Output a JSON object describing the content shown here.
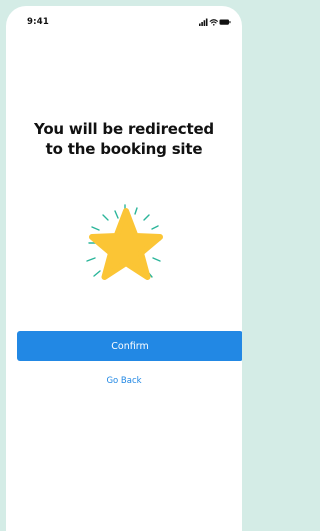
{
  "status_bar": {
    "time": "9:41",
    "signal_icon": "cellular-signal-icon",
    "wifi_icon": "wifi-icon",
    "battery_icon": "battery-icon"
  },
  "dialog": {
    "title_line_1": "You will be redirected",
    "title_line_2": "to the booking site",
    "illustration": "star-icon",
    "confirm_label": "Confirm",
    "back_label": "Go Back"
  },
  "colors": {
    "page_background": "#d4ece6",
    "accent": "#2288e4",
    "star": "#fbc535",
    "sparkles": "#2bb59a"
  }
}
